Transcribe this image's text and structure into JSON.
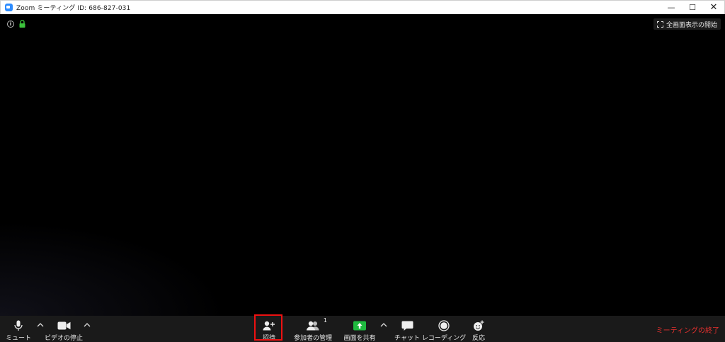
{
  "window": {
    "title": "Zoom ミーティング ID: 686-827-031",
    "minimize": "—",
    "maximize": "☐",
    "close": "✕"
  },
  "overlay": {
    "info_icon": "i",
    "fullscreen_label": "全画面表示の開始"
  },
  "toolbar": {
    "mute_label": "ミュート",
    "video_label": "ビデオの停止",
    "invite_label": "招待",
    "participants_label": "参加者の管理",
    "participants_count": "1",
    "share_label": "画面を共有",
    "chat_label": "チャット",
    "record_label": "レコーディング",
    "reactions_label": "反応",
    "end_label": "ミーティングの終了"
  },
  "colors": {
    "share_green": "#1fba3f",
    "end_red": "#e8312f",
    "highlight_red": "#e11111",
    "lock_green": "#3cc33c"
  }
}
